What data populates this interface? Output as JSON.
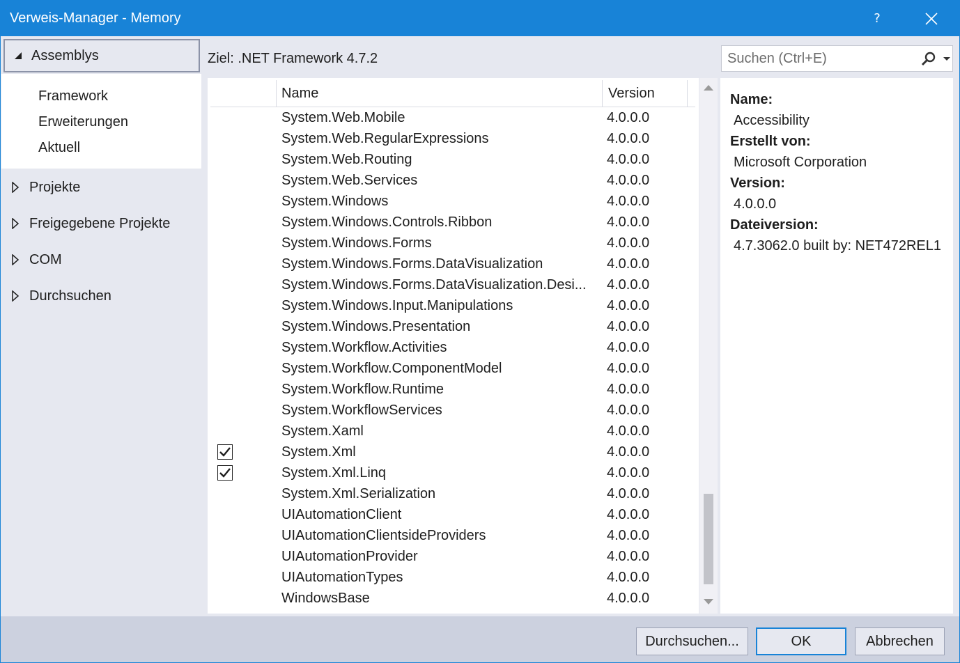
{
  "window": {
    "title": "Verweis-Manager - Memory",
    "help_label": "?",
    "accent_color": "#1883d7"
  },
  "sidebar": {
    "expanded": {
      "label": "Assemblys",
      "icon": "expanded-triangle-icon"
    },
    "sub_items": [
      {
        "label": "Framework"
      },
      {
        "label": "Erweiterungen"
      },
      {
        "label": "Aktuell"
      }
    ],
    "items": [
      {
        "label": "Projekte",
        "icon": "collapsed-triangle-icon"
      },
      {
        "label": "Freigegebene Projekte",
        "icon": "collapsed-triangle-icon"
      },
      {
        "label": "COM",
        "icon": "collapsed-triangle-icon"
      },
      {
        "label": "Durchsuchen",
        "icon": "collapsed-triangle-icon"
      }
    ]
  },
  "toolbar": {
    "target_label": "Ziel: .NET Framework 4.7.2",
    "search_placeholder": "Suchen (Ctrl+E)"
  },
  "table": {
    "columns": {
      "name": "Name",
      "version": "Version"
    },
    "rows": [
      {
        "name": "System.Web.Mobile",
        "version": "4.0.0.0",
        "checked": false
      },
      {
        "name": "System.Web.RegularExpressions",
        "version": "4.0.0.0",
        "checked": false
      },
      {
        "name": "System.Web.Routing",
        "version": "4.0.0.0",
        "checked": false
      },
      {
        "name": "System.Web.Services",
        "version": "4.0.0.0",
        "checked": false
      },
      {
        "name": "System.Windows",
        "version": "4.0.0.0",
        "checked": false
      },
      {
        "name": "System.Windows.Controls.Ribbon",
        "version": "4.0.0.0",
        "checked": false
      },
      {
        "name": "System.Windows.Forms",
        "version": "4.0.0.0",
        "checked": false
      },
      {
        "name": "System.Windows.Forms.DataVisualization",
        "version": "4.0.0.0",
        "checked": false
      },
      {
        "name": "System.Windows.Forms.DataVisualization.Desi...",
        "version": "4.0.0.0",
        "checked": false
      },
      {
        "name": "System.Windows.Input.Manipulations",
        "version": "4.0.0.0",
        "checked": false
      },
      {
        "name": "System.Windows.Presentation",
        "version": "4.0.0.0",
        "checked": false
      },
      {
        "name": "System.Workflow.Activities",
        "version": "4.0.0.0",
        "checked": false
      },
      {
        "name": "System.Workflow.ComponentModel",
        "version": "4.0.0.0",
        "checked": false
      },
      {
        "name": "System.Workflow.Runtime",
        "version": "4.0.0.0",
        "checked": false
      },
      {
        "name": "System.WorkflowServices",
        "version": "4.0.0.0",
        "checked": false
      },
      {
        "name": "System.Xaml",
        "version": "4.0.0.0",
        "checked": false
      },
      {
        "name": "System.Xml",
        "version": "4.0.0.0",
        "checked": true
      },
      {
        "name": "System.Xml.Linq",
        "version": "4.0.0.0",
        "checked": true
      },
      {
        "name": "System.Xml.Serialization",
        "version": "4.0.0.0",
        "checked": false
      },
      {
        "name": "UIAutomationClient",
        "version": "4.0.0.0",
        "checked": false
      },
      {
        "name": "UIAutomationClientsideProviders",
        "version": "4.0.0.0",
        "checked": false
      },
      {
        "name": "UIAutomationProvider",
        "version": "4.0.0.0",
        "checked": false
      },
      {
        "name": "UIAutomationTypes",
        "version": "4.0.0.0",
        "checked": false
      },
      {
        "name": "WindowsBase",
        "version": "4.0.0.0",
        "checked": false
      }
    ]
  },
  "details": {
    "name_label": "Name:",
    "name_value": "Accessibility",
    "author_label": "Erstellt von:",
    "author_value": "Microsoft Corporation",
    "version_label": "Version:",
    "version_value": "4.0.0.0",
    "file_version_label": "Dateiversion:",
    "file_version_value": "4.7.3062.0 built by: NET472REL1"
  },
  "footer": {
    "browse_label": "Durchsuchen...",
    "ok_label": "OK",
    "cancel_label": "Abbrechen"
  }
}
